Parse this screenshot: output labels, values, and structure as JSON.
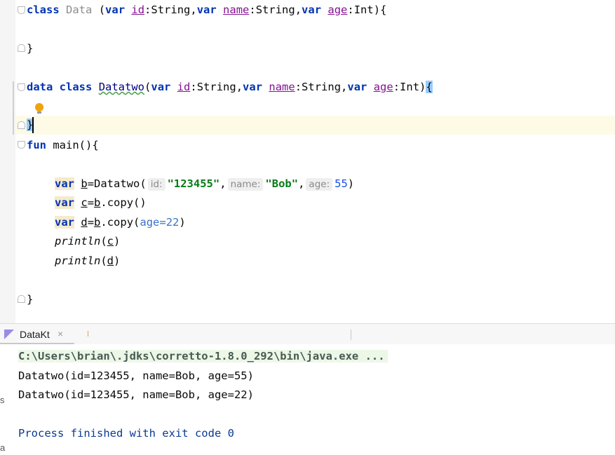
{
  "editor": {
    "class_line": {
      "kw_class": "class",
      "name": "Data",
      "paren": "(",
      "var1": "var",
      "p1": "id",
      "t1": ":String,",
      "var2": "var",
      "p2": "name",
      "t2": ":String,",
      "var3": "var",
      "p3": "age",
      "t3": ":Int){"
    },
    "close_brace_1": "}",
    "dataclass_line": {
      "kw_data": "data",
      "kw_class": "class",
      "name": "Datatwo",
      "paren": "(",
      "var1": "var",
      "p1": "id",
      "t1": ":String,",
      "var2": "var",
      "p2": "name",
      "t2": ":String,",
      "var3": "var",
      "p3": "age",
      "t3": ":Int)",
      "brace": "{"
    },
    "close_brace_2": "}",
    "fun_line": {
      "kw_fun": "fun",
      "rest": "main(){"
    },
    "line_b": {
      "kw": "var",
      "name": "b",
      "eq": "=Datatwo(",
      "hint_id": "id:",
      "arg1": "\"123455\"",
      "comma1": ",",
      "hint_name": "name:",
      "arg2": "\"Bob\"",
      "comma2": ",",
      "hint_age": "age:",
      "arg3": "55",
      "close": ")"
    },
    "line_c": {
      "kw": "var",
      "name": "c",
      "eq": "=",
      "ref": "b",
      "call": ".copy()"
    },
    "line_d": {
      "kw": "var",
      "name": "d",
      "eq": "=",
      "ref": "b",
      "call": ".copy(",
      "named": "age=22",
      "close": ")"
    },
    "line_p1": {
      "fn": "println",
      "open": "(",
      "arg": "c",
      "close": ")"
    },
    "line_p2": {
      "fn": "println",
      "open": "(",
      "arg": "d",
      "close": ")"
    },
    "close_brace_3": "}"
  },
  "run_panel": {
    "tab_label": "DataKt",
    "close_glyph": "×"
  },
  "console": {
    "command": "C:\\Users\\brian\\.jdks\\corretto-1.8.0_292\\bin\\java.exe ...",
    "out1": "Datatwo(id=123455, name=Bob, age=55)",
    "out2": "Datatwo(id=123455, name=Bob, age=22)",
    "exit": "Process finished with exit code 0",
    "side_glyph_1": "s",
    "side_glyph_2": "a"
  },
  "colors": {
    "keyword": "#0033b3",
    "property": "#871094",
    "string": "#067d17",
    "number": "#1750eb",
    "caret_line": "#fdfbe6"
  },
  "icons": [
    "fold-icon",
    "lightbulb-icon",
    "kotlin-icon",
    "close-icon"
  ]
}
